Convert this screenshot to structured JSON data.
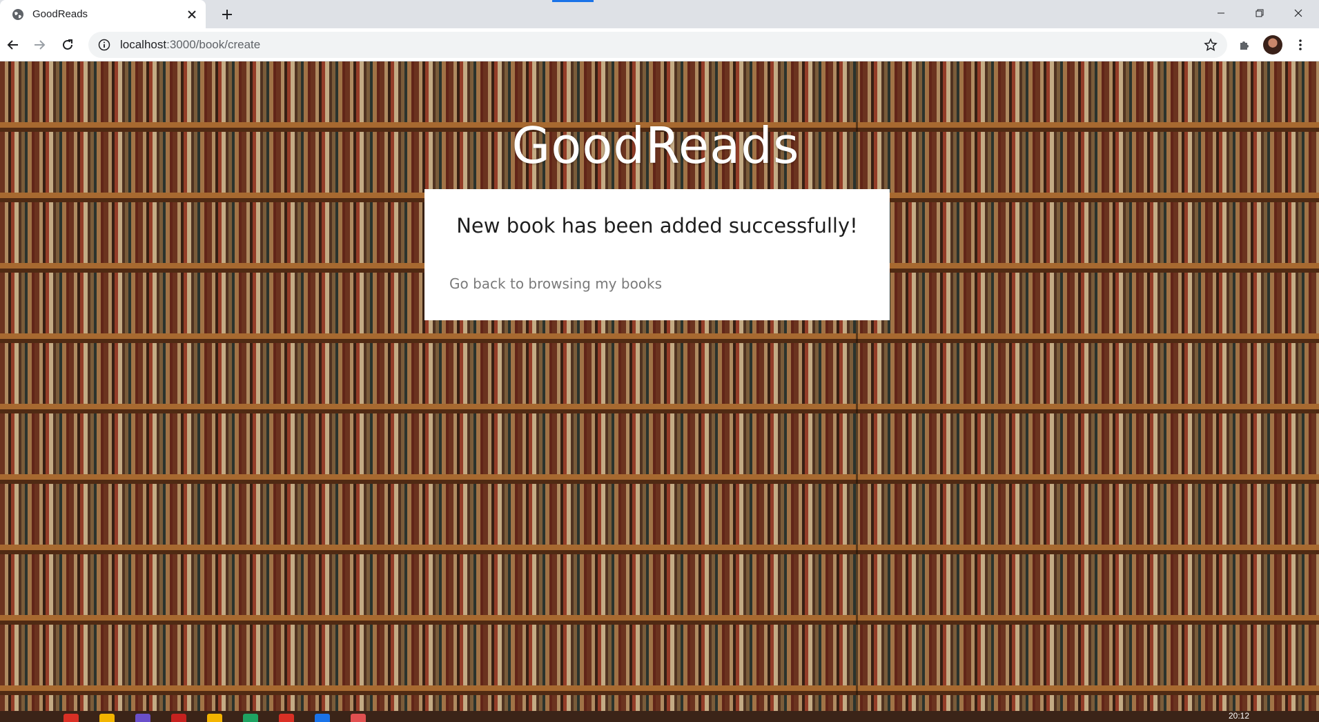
{
  "browser": {
    "tab": {
      "title": "GoodReads",
      "icon": "globe-icon",
      "close_icon": "close-icon"
    },
    "new_tab_icon": "plus-icon",
    "window_controls": [
      "minimize-icon",
      "restore-icon",
      "close-icon"
    ],
    "nav": {
      "back_icon": "arrow-left-icon",
      "forward_icon": "arrow-right-icon",
      "reload_icon": "reload-icon"
    },
    "address_bar": {
      "host": "localhost",
      "path": ":3000/book/create",
      "info_icon": "info-icon",
      "bookmark_icon": "star-icon"
    },
    "extensions_icon": "puzzle-icon",
    "menu_icon": "more-vertical-icon"
  },
  "page": {
    "site_title": "GoodReads",
    "card": {
      "message": "New book has been added successfully!",
      "back_link": "Go back to browsing my books"
    }
  },
  "taskbar": {
    "clock": "20:12",
    "icon_colors": [
      "#d93025",
      "#f2b400",
      "#6a4fc9",
      "#c5221f",
      "#f4b400",
      "#1ea362",
      "#d93025",
      "#1a73e8",
      "#e05050"
    ]
  },
  "colors": {
    "tabstrip": "#dee1e6",
    "card_background": "#ffffff",
    "link_text": "#7a7a7a",
    "title_text": "#ffffff"
  }
}
